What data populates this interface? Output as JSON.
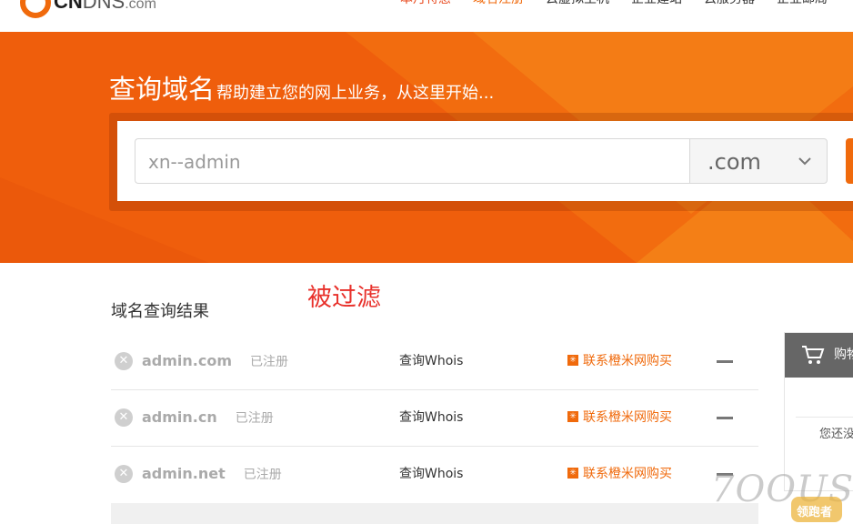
{
  "brand": {
    "logo_cn": "CN",
    "logo_dns": "DNS",
    "logo_com": ".com"
  },
  "nav": {
    "items": [
      {
        "label": "本月特惠",
        "style": "hot"
      },
      {
        "label": "域名注册",
        "style": "active"
      },
      {
        "label": "云虚拟主机",
        "style": "normal"
      },
      {
        "label": "企业建站",
        "style": "normal"
      },
      {
        "label": "云服务器",
        "style": "normal"
      },
      {
        "label": "企业邮局",
        "style": "normal"
      }
    ]
  },
  "banner": {
    "title": "查询域名",
    "subtitle": "帮助建立您的网上业务，从这里开始...",
    "search_value": "xn--admin",
    "tld_value": ".com",
    "background_color": "#ef5e0c"
  },
  "annotation": "被过滤",
  "results": {
    "title": "域名查询结果",
    "rows": [
      {
        "domain": "admin.com",
        "status": "已注册",
        "whois": "查询Whois",
        "buy": "联系橙米网购买"
      },
      {
        "domain": "admin.cn",
        "status": "已注册",
        "whois": "查询Whois",
        "buy": "联系橙米网购买"
      },
      {
        "domain": "admin.net",
        "status": "已注册",
        "whois": "查询Whois",
        "buy": "联系橙米网购买"
      }
    ]
  },
  "cart": {
    "title": "购物车",
    "empty_text": "您还没"
  },
  "watermark": {
    "text": "7OOUS",
    "badge": "领跑者"
  },
  "colors": {
    "accent": "#f06a0c",
    "annotation": "#e8302a",
    "cart_header": "#666666"
  },
  "icons": {
    "remove": "close-circle-icon",
    "buy": "asterisk-icon",
    "cart": "shopping-cart-icon",
    "dropdown": "chevron-down-icon"
  }
}
